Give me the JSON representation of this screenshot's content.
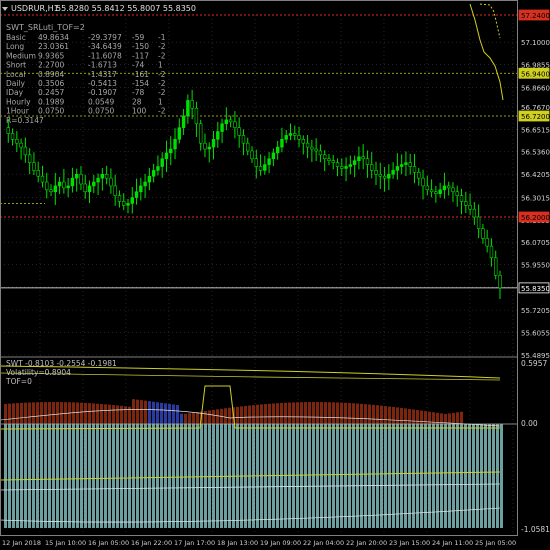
{
  "header": {
    "symbol_label": "USDRUR,H1",
    "ohlc": "55.8280 55.8412 55.8007 55.8350"
  },
  "indicator_title": "SWT_SRLuti_TOF=2",
  "stats_rows": [
    [
      "Basic",
      "49.8634",
      "-29.3797",
      "-59",
      "-1"
    ],
    [
      "Long",
      "23.0361",
      "-34.6439",
      "-150",
      "-2"
    ],
    [
      "Medium",
      "9.9365",
      "-11.6078",
      "-117",
      "-2"
    ],
    [
      "Short",
      "2.2700",
      "-1.6713",
      "-74",
      "1"
    ],
    [
      "Local",
      "0.8904",
      "-1.4317",
      "-161",
      "-2"
    ],
    [
      "Daily",
      "0.3506",
      "-0.5413",
      "-154",
      "-2"
    ],
    [
      "IDay",
      "0.2457",
      "-0.1907",
      "-78",
      "-2"
    ],
    [
      "Hourly",
      "0.1989",
      "0.0549",
      "28",
      "1"
    ],
    [
      "1Hour",
      "0.0750",
      "0.0750",
      "100",
      "-2"
    ]
  ],
  "stats_extra": "R=0.3147",
  "price_axis": [
    "57.1000",
    "56.9855",
    "56.8660",
    "56.7670",
    "56.6515",
    "56.5360",
    "56.4205",
    "56.3015",
    "56.1855",
    "56.0705",
    "55.9550",
    "55.8395",
    "55.7205",
    "55.6055",
    "55.4895"
  ],
  "level_labels": [
    {
      "text": "57.2400",
      "color": "#d83020"
    },
    {
      "text": "56.9400",
      "color": "#d0d020"
    },
    {
      "text": "56.7200",
      "color": "#d0d020"
    },
    {
      "text": "56.2000",
      "color": "#d83020"
    },
    {
      "text": "55.8350",
      "color": "#ffffff"
    }
  ],
  "sub": {
    "header": "SWT -0.8103 -0.2554 -0.1981",
    "volatility": "Volatility=0.8904",
    "tof": "TOF=0",
    "axis_top": "0.5957",
    "axis_mid": "0.00",
    "axis_bottom": "-1.0581"
  },
  "time_axis": [
    "12 Jan 2018",
    "15 Jan 10:00",
    "16 Jan 05:00",
    "16 Jan 22:00",
    "17 Jan 17:00",
    "18 Jan 13:00",
    "19 Jan 09:00",
    "22 Jan 04:00",
    "22 Jan 20:00",
    "23 Jan 15:00",
    "24 Jan 11:00",
    "25 Jan 05:00"
  ],
  "colors": {
    "bull": "#00e000",
    "bear": "#ffffff",
    "grid": "#3a3a3a",
    "red": "#d83020",
    "yellow": "#d0d020",
    "teal": "#7fbcbc",
    "brown": "#8a2a10",
    "blue": "#3040b0"
  },
  "chart_data": {
    "type": "candlestick",
    "symbol": "USDRUR",
    "timeframe": "H1",
    "y_range": [
      55.4895,
      57.24
    ],
    "close_series": [
      56.66,
      56.63,
      56.6,
      56.58,
      56.56,
      56.52,
      56.48,
      56.44,
      56.41,
      56.38,
      56.34,
      56.33,
      56.36,
      56.38,
      56.35,
      56.36,
      56.4,
      56.42,
      56.37,
      56.33,
      56.36,
      56.38,
      56.4,
      56.42,
      56.4,
      56.36,
      56.31,
      56.28,
      56.26,
      56.27,
      56.3,
      56.33,
      56.36,
      56.38,
      56.41,
      56.44,
      56.46,
      56.5,
      56.53,
      56.55,
      56.6,
      56.66,
      56.72,
      56.8,
      56.76,
      56.68,
      56.58,
      56.55,
      56.56,
      56.6,
      56.64,
      56.68,
      56.7,
      56.69,
      56.66,
      56.62,
      56.58,
      56.54,
      56.5,
      56.46,
      56.44,
      56.47,
      56.5,
      56.53,
      56.56,
      56.6,
      56.62,
      56.63,
      56.62,
      56.6,
      56.58,
      56.56,
      56.55,
      56.54,
      56.52,
      56.5,
      56.49,
      56.48,
      56.46,
      56.45,
      56.46,
      56.47,
      56.49,
      56.51,
      56.5,
      56.47,
      56.44,
      56.42,
      56.41,
      56.4,
      56.42,
      56.44,
      56.46,
      56.47,
      56.48,
      56.46,
      56.43,
      56.4,
      56.36,
      56.34,
      56.33,
      56.32,
      56.34,
      56.36,
      56.35,
      56.33,
      56.31,
      56.28,
      56.26,
      56.24,
      56.2,
      56.14,
      56.09,
      56.05,
      55.99,
      55.9,
      55.835
    ],
    "levels": [
      57.24,
      56.94,
      56.72,
      56.2,
      55.835
    ]
  }
}
